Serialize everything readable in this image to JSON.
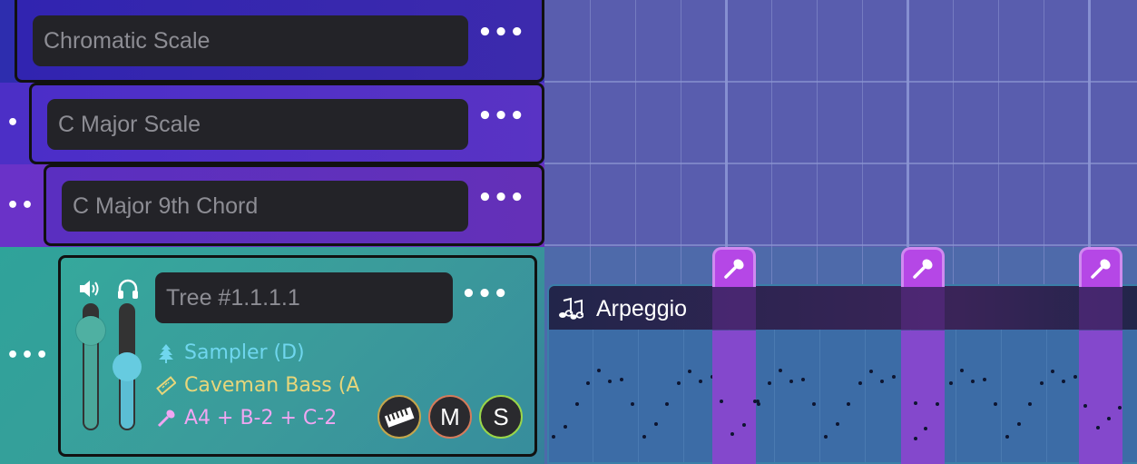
{
  "tracks": [
    {
      "name": "Chromatic Scale",
      "menu": "•••",
      "indent": ""
    },
    {
      "name": "C Major Scale",
      "menu": "•••",
      "indent": "•"
    },
    {
      "name": "C Major 9th Chord",
      "menu": "•••",
      "indent": "••"
    }
  ],
  "instrument": {
    "indent": "•••",
    "name": "Tree #1.1.1.1",
    "menu": "•••",
    "sampler": "Sampler (D)",
    "bass": "Caveman Bass (A",
    "notes": "A4 + B-2 + C-2",
    "volume_level": 0.85,
    "headphone_level": 0.57,
    "buttons": {
      "piano": "piano-icon",
      "mute": "M",
      "solo": "S"
    }
  },
  "clip": {
    "title": "Arpeggio",
    "icon": "music-notes-icon"
  },
  "markers": {
    "icon": "microphone-icon",
    "count": 3
  },
  "colors": {
    "track1": "#2d2dae",
    "track2": "#4c2fc6",
    "track3": "#6a32c8",
    "instrument_bg": "#2fa39a",
    "marker": "#b547e6",
    "sampler_text": "#6fd6ee",
    "bass_text": "#e8d67a",
    "notes_text": "#f0a6f2"
  }
}
